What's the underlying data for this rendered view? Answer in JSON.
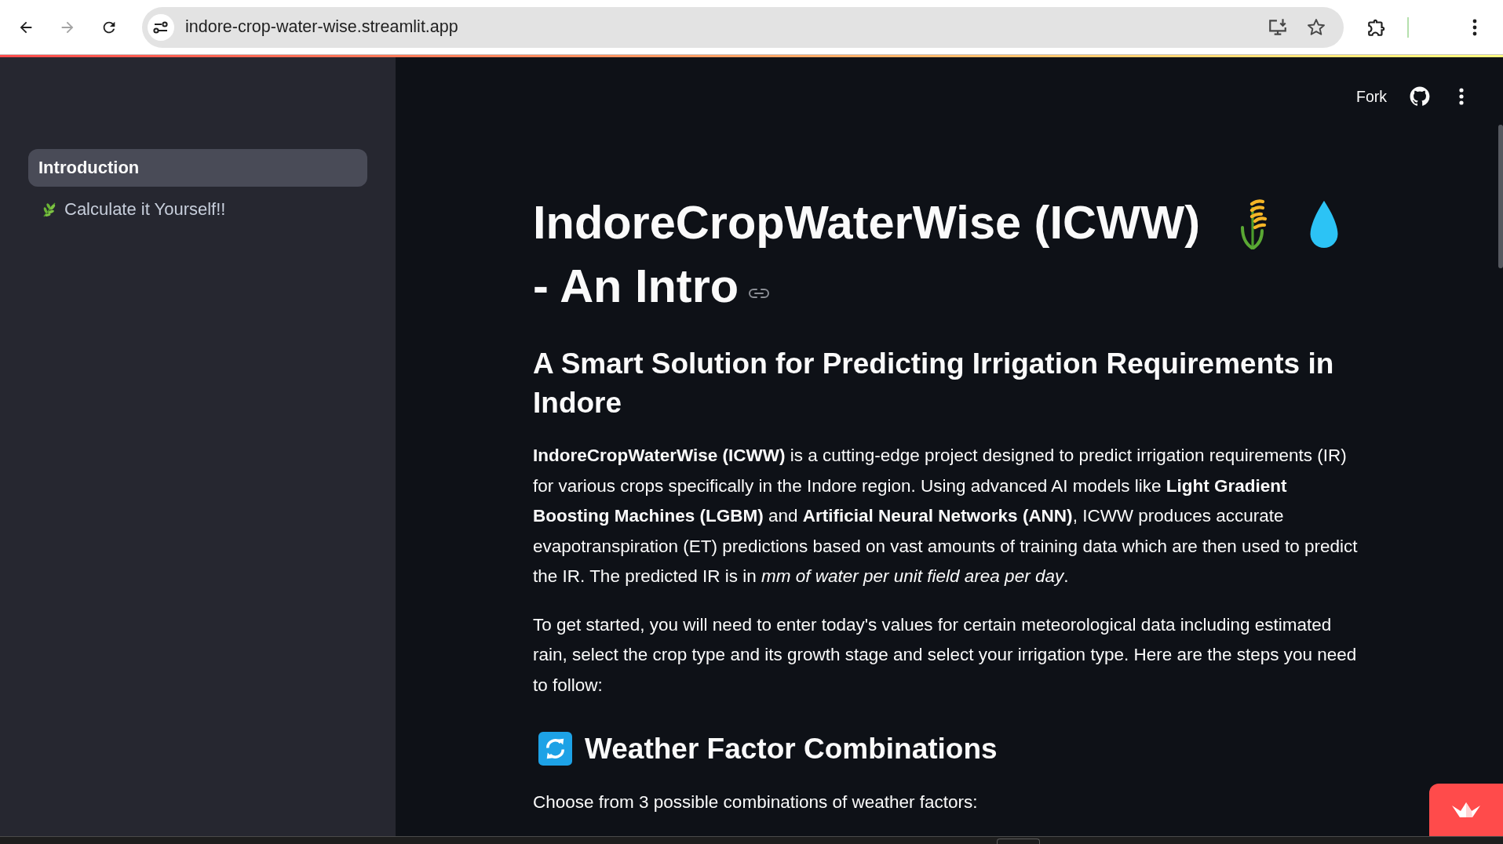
{
  "browser": {
    "nav_buttons": [
      {
        "kind": "back",
        "disabled": false
      },
      {
        "kind": "forward",
        "disabled": true
      },
      {
        "kind": "reload",
        "disabled": false
      }
    ],
    "url": "indore-crop-water-wise.streamlit.app"
  },
  "sidebar": {
    "items": [
      {
        "label": "Introduction",
        "kind": "plain",
        "selected": true
      },
      {
        "label": "Calculate it Yourself!!",
        "kind": "iconed",
        "selected": false
      }
    ]
  },
  "header": {
    "fork": "Fork"
  },
  "title": {
    "lead": "IndoreCropWaterWise (ICWW)",
    "tail": "- An Intro"
  },
  "subtitle": "A Smart Solution for Predicting Irrigation Requirements in Indore",
  "paragraphs": [
    "**IndoreCropWaterWise (ICWW)** is a cutting-edge project designed to predict irrigation requirements (IR) for various crops specifically in the Indore region. Using advanced AI models like **Light Gradient Boosting Machines (LGBM)** and **Artificial Neural Networks (ANN)**, ICWW produces accurate evapotranspiration (ET) predictions based on vast amounts of training data which are then used to predict the IR. The predicted IR is in *mm of water per unit field area per day*.",
    "To get started, you will need to enter today's values for certain meteorological data including estimated rain, select the crop type and its growth stage and select your irrigation type. Here are the steps you need to follow:"
  ],
  "section": {
    "heading": "Weather Factor Combinations",
    "text": "Choose from 3 possible combinations of weather factors:"
  }
}
